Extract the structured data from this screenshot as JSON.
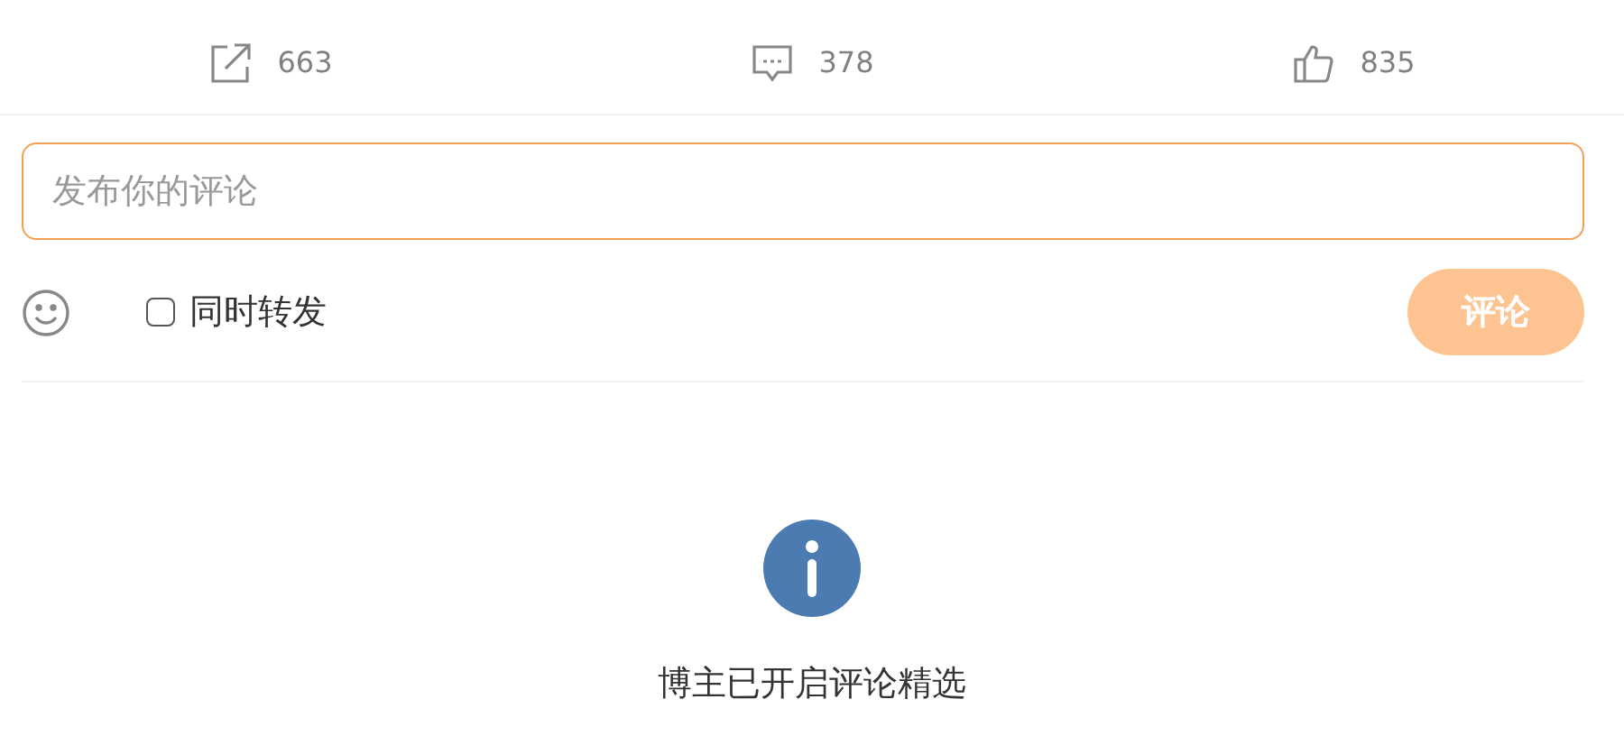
{
  "actions": [
    {
      "kind": "share",
      "count": "663"
    },
    {
      "kind": "comment",
      "count": "378"
    },
    {
      "kind": "like",
      "count": "835"
    }
  ],
  "composer": {
    "placeholder": "发布你的评论",
    "repost": {
      "label": "同时转发",
      "checked": false
    },
    "submit": {
      "label": "评论",
      "disabled": true
    }
  },
  "notice": {
    "text": "博主已开启评论精选"
  }
}
